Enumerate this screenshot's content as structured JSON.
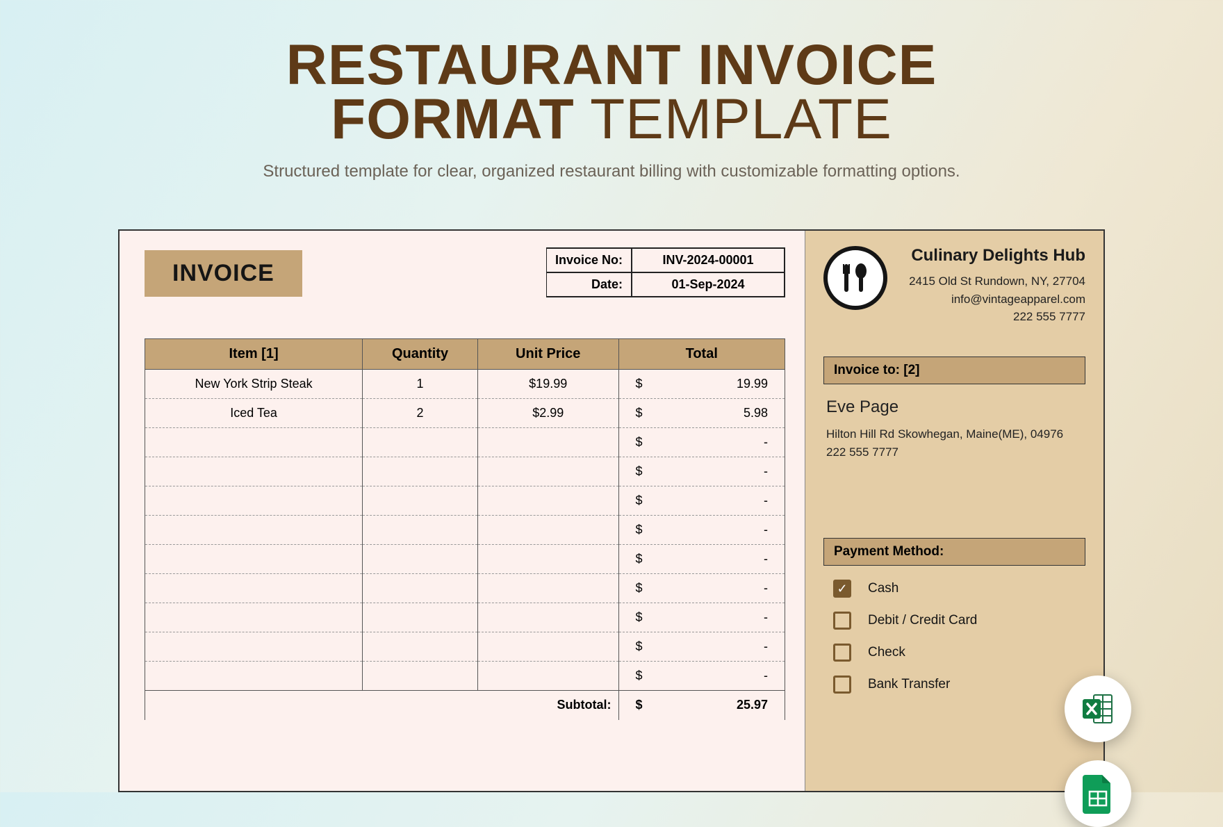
{
  "hero": {
    "title_line1": "RESTAURANT INVOICE",
    "title_line2_bold": "FORMAT",
    "title_line2_thin": " TEMPLATE",
    "subtitle": "Structured template for clear, organized restaurant billing with customizable formatting options."
  },
  "invoice": {
    "badge": "INVOICE",
    "meta": {
      "no_label": "Invoice No:",
      "no_value": "INV-2024-00001",
      "date_label": "Date:",
      "date_value": "01-Sep-2024"
    },
    "columns": {
      "item": "Item [1]",
      "qty": "Quantity",
      "price": "Unit Price",
      "total": "Total"
    },
    "rows": [
      {
        "item": "New York Strip Steak",
        "qty": "1",
        "price": "$19.99",
        "total": "19.99"
      },
      {
        "item": "Iced Tea",
        "qty": "2",
        "price": "$2.99",
        "total": "5.98"
      },
      {
        "item": "",
        "qty": "",
        "price": "",
        "total": "-"
      },
      {
        "item": "",
        "qty": "",
        "price": "",
        "total": "-"
      },
      {
        "item": "",
        "qty": "",
        "price": "",
        "total": "-"
      },
      {
        "item": "",
        "qty": "",
        "price": "",
        "total": "-"
      },
      {
        "item": "",
        "qty": "",
        "price": "",
        "total": "-"
      },
      {
        "item": "",
        "qty": "",
        "price": "",
        "total": "-"
      },
      {
        "item": "",
        "qty": "",
        "price": "",
        "total": "-"
      },
      {
        "item": "",
        "qty": "",
        "price": "",
        "total": "-"
      },
      {
        "item": "",
        "qty": "",
        "price": "",
        "total": "-"
      }
    ],
    "currency": "$",
    "subtotal_label": "Subtotal:",
    "subtotal_value": "25.97"
  },
  "business": {
    "name": "Culinary Delights Hub",
    "address": "2415 Old St Rundown, NY, 27704",
    "email": "info@vintageapparel.com",
    "phone": "222 555 7777"
  },
  "invoice_to": {
    "header": "Invoice to: [2]",
    "name": "Eve Page",
    "address": "Hilton Hill Rd Skowhegan, Maine(ME), 04976",
    "phone": "222 555 7777"
  },
  "payment": {
    "header": "Payment Method:",
    "methods": [
      {
        "label": "Cash",
        "checked": true
      },
      {
        "label": "Debit / Credit Card",
        "checked": false
      },
      {
        "label": "Check",
        "checked": false
      },
      {
        "label": "Bank Transfer",
        "checked": false
      }
    ]
  },
  "fabs": {
    "excel": "excel-icon",
    "sheets": "sheets-icon"
  }
}
